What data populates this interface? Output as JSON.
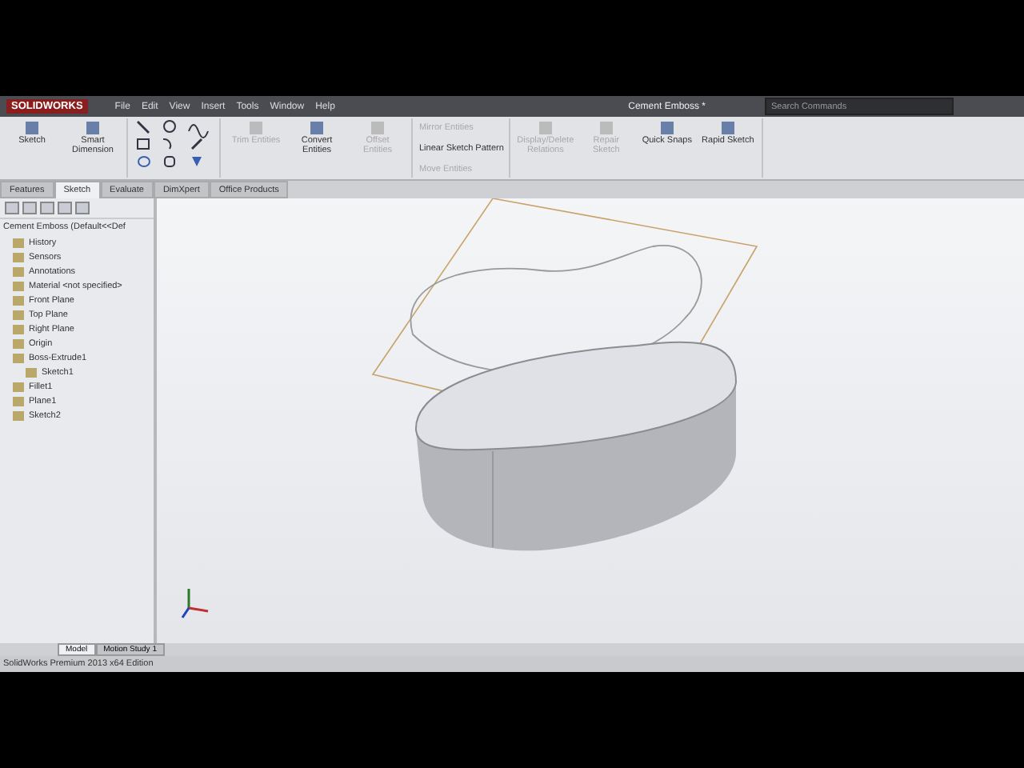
{
  "title_bar": {
    "logo": "SOLIDWORKS",
    "menu": [
      "File",
      "Edit",
      "View",
      "Insert",
      "Tools",
      "Window",
      "Help"
    ],
    "document_title": "Cement Emboss *",
    "search": {
      "placeholder": "Search Commands"
    }
  },
  "command_manager": {
    "groups": [
      {
        "kind": "big",
        "items": [
          {
            "label": "Sketch",
            "disabled": false
          },
          {
            "label": "Smart Dimension",
            "disabled": false
          }
        ]
      },
      {
        "kind": "grid"
      },
      {
        "kind": "big",
        "items": [
          {
            "label": "Trim Entities",
            "disabled": true
          },
          {
            "label": "Convert Entities",
            "disabled": false
          },
          {
            "label": "Offset Entities",
            "disabled": true
          }
        ]
      },
      {
        "kind": "list",
        "items": [
          {
            "label": "Mirror Entities",
            "disabled": true
          },
          {
            "label": "Linear Sketch Pattern",
            "disabled": false
          },
          {
            "label": "Move Entities",
            "disabled": true
          }
        ]
      },
      {
        "kind": "big",
        "items": [
          {
            "label": "Display/Delete Relations",
            "disabled": true
          },
          {
            "label": "Repair Sketch",
            "disabled": true
          },
          {
            "label": "Quick Snaps",
            "disabled": false
          },
          {
            "label": "Rapid Sketch",
            "disabled": false
          }
        ]
      }
    ]
  },
  "tabs": [
    {
      "label": "Features",
      "selected": false
    },
    {
      "label": "Sketch",
      "selected": true
    },
    {
      "label": "Evaluate",
      "selected": false
    },
    {
      "label": "DimXpert",
      "selected": false
    },
    {
      "label": "Office Products",
      "selected": false
    }
  ],
  "feature_tree": {
    "root": "Cement Emboss (Default<<Def",
    "items": [
      {
        "label": "History"
      },
      {
        "label": "Sensors"
      },
      {
        "label": "Annotations"
      },
      {
        "label": "Material <not specified>"
      },
      {
        "label": "Front Plane"
      },
      {
        "label": "Top Plane"
      },
      {
        "label": "Right Plane"
      },
      {
        "label": "Origin"
      },
      {
        "label": "Boss-Extrude1",
        "children": [
          {
            "label": "Sketch1"
          }
        ]
      },
      {
        "label": "Fillet1"
      },
      {
        "label": "Plane1"
      },
      {
        "label": "Sketch2"
      }
    ]
  },
  "bottom_tabs": [
    {
      "label": "Model",
      "selected": true
    },
    {
      "label": "Motion Study 1",
      "selected": false
    }
  ],
  "status_bar": "SolidWorks Premium 2013 x64 Edition"
}
